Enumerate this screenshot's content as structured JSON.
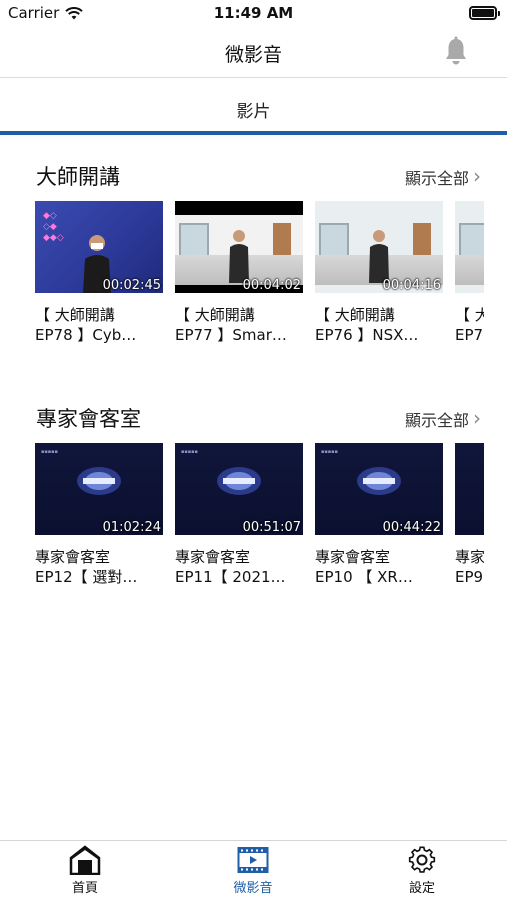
{
  "status_bar": {
    "carrier": "Carrier",
    "time": "11:49 AM"
  },
  "nav": {
    "title": "微影音",
    "bell_icon": "bell-icon"
  },
  "tab": {
    "label": "影片"
  },
  "sections": [
    {
      "title": "大師開講",
      "show_all": "顯示全部",
      "cards": [
        {
          "line1": "【 大師開講",
          "line2": "EP78 】Cyb…",
          "duration": "00:02:45"
        },
        {
          "line1": "【 大師開講",
          "line2": "EP77 】Smar…",
          "duration": "00:04:02"
        },
        {
          "line1": "【 大師開講",
          "line2": "EP76 】NSX…",
          "duration": "00:04:16"
        },
        {
          "line1": "【 大",
          "line2": "EP7",
          "duration": ""
        }
      ]
    },
    {
      "title": "專家會客室",
      "show_all": "顯示全部",
      "cards": [
        {
          "line1": "專家會客室",
          "line2": "EP12【 選對…",
          "duration": "01:02:24"
        },
        {
          "line1": "專家會客室",
          "line2": "EP11【 2021…",
          "duration": "00:51:07"
        },
        {
          "line1": "專家會客室",
          "line2": "EP10 【 XR…",
          "duration": "00:44:22"
        },
        {
          "line1": "專家",
          "line2": "EP9",
          "duration": ""
        }
      ]
    }
  ],
  "bottom_tabs": [
    {
      "label": "首頁",
      "icon": "home-icon"
    },
    {
      "label": "微影音",
      "icon": "film-icon"
    },
    {
      "label": "設定",
      "icon": "gear-icon"
    }
  ],
  "colors": {
    "accent": "#1f5fa8"
  }
}
